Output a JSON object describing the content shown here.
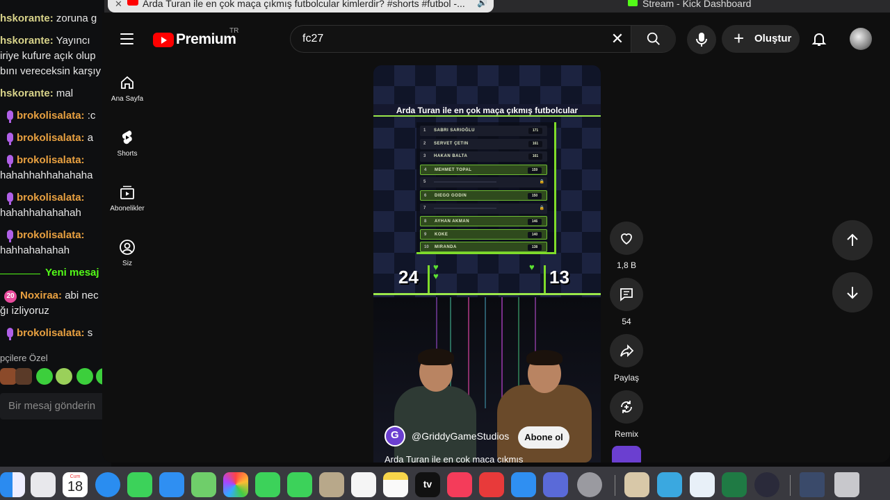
{
  "browser": {
    "active_tab_title": "Arda Turan ile en çok maça çıkmış futbolcular kimlerdir? #shorts #futbol -...",
    "second_tab_title": "Stream - Kick Dashboard"
  },
  "kick_chat": {
    "lines": [
      {
        "user": "hskorante:",
        "text": " zoruna g",
        "mic": false
      },
      {
        "user": "hskorante:",
        "text": " Yayıncı",
        "mic": false
      },
      {
        "user": "",
        "text": "iriye kufure açık olup",
        "mic": false
      },
      {
        "user": "",
        "text": "bını vereceksin karşıy",
        "mic": false
      },
      {
        "user": "hskorante:",
        "text": " mal",
        "mic": false
      },
      {
        "user": "brokolisalata:",
        "text": " :c",
        "mic": true
      },
      {
        "user": "brokolisalata:",
        "text": " a",
        "mic": true
      },
      {
        "user": "brokolisalata:",
        "text": "",
        "mic": true
      },
      {
        "user": "",
        "text": "hahahhahhahahaha",
        "mic": false
      },
      {
        "user": "brokolisalata:",
        "text": "",
        "mic": true
      },
      {
        "user": "",
        "text": "hahahhahahahah",
        "mic": false
      },
      {
        "user": "brokolisalata:",
        "text": "",
        "mic": true
      },
      {
        "user": "",
        "text": "hahhahahahah",
        "mic": false
      }
    ],
    "new_messages_label": "Yeni mesaj",
    "after_lines": [
      {
        "user": "Noxiraa:",
        "text": " abi nec",
        "badge": "20"
      },
      {
        "user": "",
        "text": "ğı izliyoruz"
      },
      {
        "user": "brokolisalata:",
        "text": " s",
        "mic": true
      }
    ],
    "subscribers_label": "pçilere Özel",
    "input_placeholder": "Bir mesaj gönderin"
  },
  "youtube": {
    "brand": "Premium",
    "region": "TR",
    "search_value": "fc27",
    "create_label": "Oluştur",
    "nav": [
      {
        "label": "Ana Sayfa",
        "icon": "home-icon"
      },
      {
        "label": "Shorts",
        "icon": "shorts-icon"
      },
      {
        "label": "Abonelikler",
        "icon": "subscriptions-icon"
      },
      {
        "label": "Siz",
        "icon": "user-icon"
      }
    ],
    "short": {
      "title_overlay": "Arda Turan ile en çok maça çıkmış futbolcular",
      "leaderboard": [
        {
          "rank": "1",
          "name": "SABRI SARIOĞLU",
          "value": "171",
          "revealed": true,
          "highlight": false
        },
        {
          "rank": "2",
          "name": "SERVET ÇETIN",
          "value": "161",
          "revealed": true,
          "highlight": false
        },
        {
          "rank": "3",
          "name": "HAKAN BALTA",
          "value": "161",
          "revealed": true,
          "highlight": false
        },
        {
          "rank": "4",
          "name": "MEHMET TOPAL",
          "value": "159",
          "revealed": true,
          "highlight": true
        },
        {
          "rank": "5",
          "name": "",
          "value": "",
          "revealed": false,
          "highlight": false
        },
        {
          "rank": "6",
          "name": "DIEGO GODIN",
          "value": "150",
          "revealed": true,
          "highlight": true
        },
        {
          "rank": "7",
          "name": "",
          "value": "",
          "revealed": false,
          "highlight": false
        },
        {
          "rank": "8",
          "name": "AYHAN AKMAN",
          "value": "146",
          "revealed": true,
          "highlight": true
        },
        {
          "rank": "9",
          "name": "KOKE",
          "value": "140",
          "revealed": true,
          "highlight": true
        },
        {
          "rank": "10",
          "name": "MIRANDA",
          "value": "138",
          "revealed": true,
          "highlight": true
        }
      ],
      "score_left": "24",
      "score_right": "13",
      "channel_name": "@GriddyGameStudios",
      "subscribe_label": "Abone ol",
      "caption": "Arda Turan ile en çok maça çıkmış"
    },
    "actions": {
      "like_count": "1,8 B",
      "comment_count": "54",
      "share_label": "Paylaş",
      "remix_label": "Remix"
    }
  },
  "dock": {
    "calendar_month": "Cum",
    "calendar_day": "18",
    "tv_label": "tv",
    "apps": [
      "finder-icon",
      "launchpad-icon",
      "calendar-icon",
      "safari-icon",
      "messages-icon",
      "mail-icon",
      "maps-icon",
      "photos-icon",
      "facetime-icon",
      "phone-icon",
      "contacts-icon",
      "reminders-icon",
      "notes-icon",
      "appletv-icon",
      "music-icon",
      "rocket-icon",
      "appstore-icon",
      "iphone-mirroring-icon",
      "settings-icon",
      "app-icon-1",
      "app-icon-2",
      "app-icon-3",
      "excel-icon",
      "obs-icon",
      "preview-icon",
      "trash-icon"
    ]
  }
}
